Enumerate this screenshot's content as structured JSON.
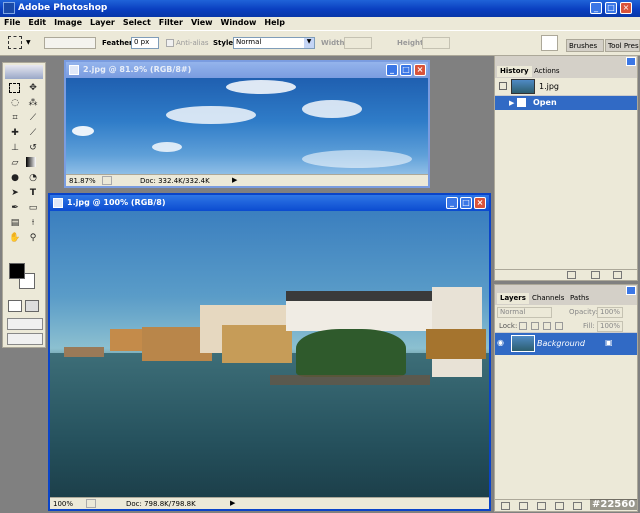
{
  "app": {
    "title": "Adobe Photoshop"
  },
  "menu": [
    "File",
    "Edit",
    "Image",
    "Layer",
    "Select",
    "Filter",
    "View",
    "Window",
    "Help"
  ],
  "options": {
    "feather_label": "Feather:",
    "feather_value": "0 px",
    "antialias_label": "Anti-alias",
    "style_label": "Style:",
    "style_value": "Normal",
    "width_label": "Width:",
    "height_label": "Height:",
    "tab_brushes": "Brushes",
    "tab_toolpresets": "Tool Prese"
  },
  "doc2": {
    "title": "2.jpg @ 81.9% (RGB/8#)",
    "zoom": "81.87%",
    "doc": "Doc: 332.4K/332.4K"
  },
  "doc1": {
    "title": "1.jpg @ 100% (RGB/8)",
    "zoom": "100%",
    "doc": "Doc: 798.8K/798.8K"
  },
  "history": {
    "tab1": "History",
    "tab2": "Actions",
    "snapshot": "1.jpg",
    "step": "Open"
  },
  "layers": {
    "tab1": "Layers",
    "tab2": "Channels",
    "tab3": "Paths",
    "mode": "Normal",
    "opacity_label": "Opacity:",
    "opacity": "100%",
    "lock_label": "Lock:",
    "fill_label": "Fill:",
    "fill": "100%",
    "layer_name": "Background"
  },
  "watermark": "#22560",
  "colors": {
    "title_blue": "#0a44c8",
    "sky": "#3f7fc0",
    "water": "#2c6070"
  }
}
